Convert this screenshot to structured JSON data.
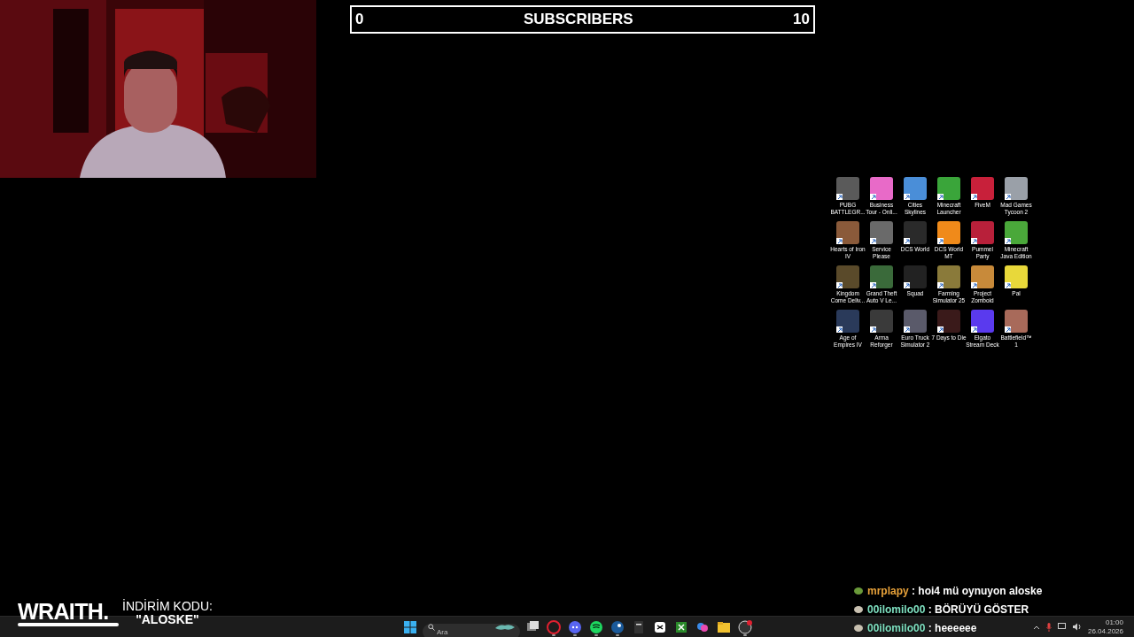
{
  "subscriber_goal": {
    "start": "0",
    "title": "SUBSCRIBERS",
    "goal": "10"
  },
  "desktop_icons": [
    {
      "label": "PUBG BATTLEGR...",
      "color": "#5a5a5a"
    },
    {
      "label": "Business Tour - Onli...",
      "color": "#e86ac8"
    },
    {
      "label": "Cities Skylines",
      "color": "#4a8ed8"
    },
    {
      "label": "Minecraft Launcher",
      "color": "#3aa53a"
    },
    {
      "label": "FiveM",
      "color": "#c8203a"
    },
    {
      "label": "Mad Games Tycoon 2",
      "color": "#9aa0a8"
    },
    {
      "label": "Hearts of Iron IV",
      "color": "#8a5a3a"
    },
    {
      "label": "Service Please",
      "color": "#6a6a6a"
    },
    {
      "label": "DCS World",
      "color": "#2a2a2a"
    },
    {
      "label": "DCS World MT",
      "color": "#f08a1a"
    },
    {
      "label": "Pummel Party",
      "color": "#b8203a"
    },
    {
      "label": "Minecraft Java Edition",
      "color": "#4aa83a"
    },
    {
      "label": "Kingdom Come Deliv...",
      "color": "#5a4a2a"
    },
    {
      "label": "Grand Theft Auto V Le...",
      "color": "#3a6a3a"
    },
    {
      "label": "Squad",
      "color": "#222222"
    },
    {
      "label": "Farming Simulator 25",
      "color": "#8a7a3a"
    },
    {
      "label": "Project Zomboid",
      "color": "#c88a3a"
    },
    {
      "label": "Pal",
      "color": "#e8d83a"
    },
    {
      "label": "Age of Empires IV",
      "color": "#2a3a5a"
    },
    {
      "label": "Arma Reforger",
      "color": "#3a3a3a"
    },
    {
      "label": "Euro Truck Simulator 2",
      "color": "#5a5a6a"
    },
    {
      "label": "7 Days to Die",
      "color": "#3a1a1a"
    },
    {
      "label": "Elgato Stream Deck",
      "color": "#5a3aee"
    },
    {
      "label": "Battlefield™ 1",
      "color": "#a86a5a"
    }
  ],
  "sponsor": {
    "brand": "WRAITH.",
    "line": "İNDİRİM KODU:",
    "code": "\"ALOSKE\""
  },
  "chat": [
    {
      "user": "mrplapy",
      "color": "#e8a23a",
      "text": ": hoi4 mü oynuyon aloske"
    },
    {
      "user": "00ilomilo00",
      "color": "#7ee0c0",
      "text": ": BÖRÜYÜ GÖSTER"
    },
    {
      "user": "00ilomilo00",
      "color": "#7ee0c0",
      "text": ": heeeeee"
    }
  ],
  "taskbar": {
    "search": {
      "placeholder": "Ara"
    },
    "apps": [
      {
        "kind": "taskview",
        "running": false
      },
      {
        "kind": "opera",
        "running": true
      },
      {
        "kind": "discord",
        "running": true
      },
      {
        "kind": "spotify",
        "running": true
      },
      {
        "kind": "steam",
        "running": true
      },
      {
        "kind": "epic",
        "running": false
      },
      {
        "kind": "capcut",
        "running": false
      },
      {
        "kind": "xbox",
        "running": false
      },
      {
        "kind": "copilot",
        "running": false
      },
      {
        "kind": "explorer",
        "running": false
      },
      {
        "kind": "obs",
        "running": true
      }
    ],
    "time": "01:00",
    "date": "26.04.2026"
  }
}
